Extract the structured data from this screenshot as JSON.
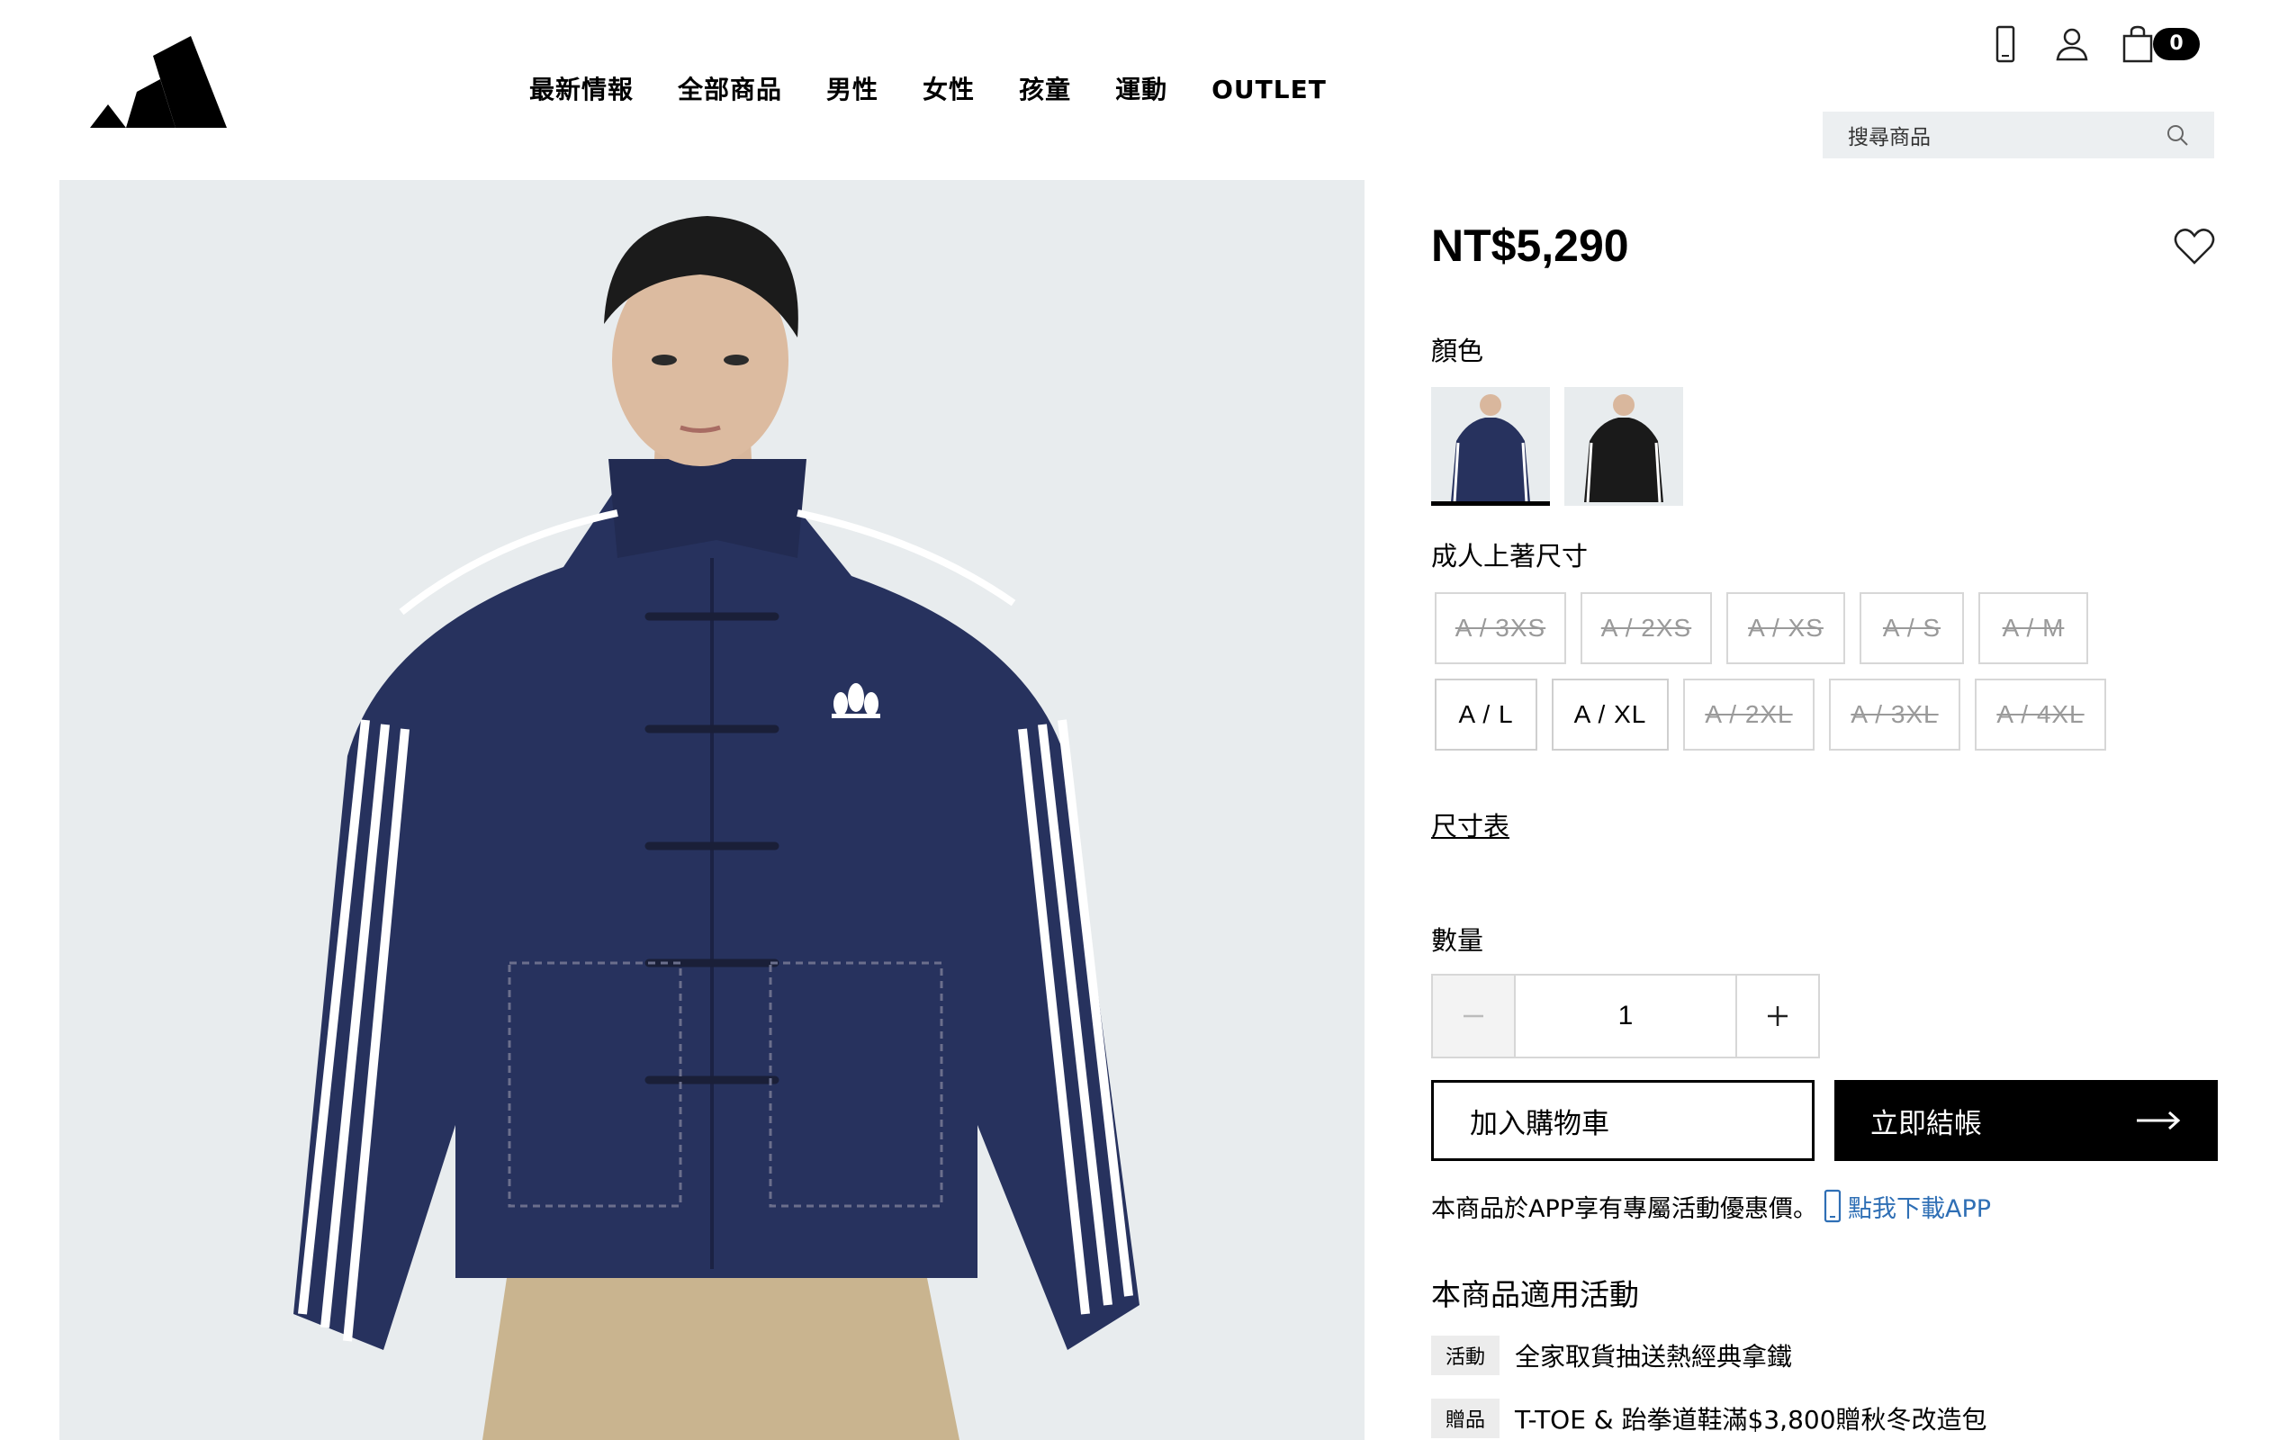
{
  "header": {
    "nav": [
      "最新情報",
      "全部商品",
      "男性",
      "女性",
      "孩童",
      "運動",
      "OUTLET"
    ],
    "cart_count": "0",
    "search_placeholder": "搜尋商品",
    "icons": [
      "adidas-logo",
      "mobile-icon",
      "user-icon",
      "bag-icon",
      "search-icon"
    ]
  },
  "product": {
    "price": "NT$5,290",
    "color_label": "顏色",
    "colors": [
      "navy-denim",
      "black"
    ],
    "size_label": "成人上著尺寸",
    "sizes": [
      [
        {
          "label": "A / 3XS",
          "available": false
        },
        {
          "label": "A / 2XS",
          "available": false
        },
        {
          "label": "A / XS",
          "available": false
        },
        {
          "label": "A / S",
          "available": false
        },
        {
          "label": "A / M",
          "available": false
        }
      ],
      [
        {
          "label": "A / L",
          "available": true
        },
        {
          "label": "A / XL",
          "available": true
        },
        {
          "label": "A / 2XL",
          "available": false
        },
        {
          "label": "A / 3XL",
          "available": false
        },
        {
          "label": "A / 4XL",
          "available": false
        }
      ]
    ],
    "size_chart": "尺寸表",
    "qty_label": "數量",
    "qty": "1",
    "add_to_cart": "加入購物車",
    "checkout": "立即結帳",
    "app_note": "本商品於APP享有專屬活動優惠價。",
    "app_link": "點我下載APP",
    "promo_title": "本商品適用活動",
    "promos": [
      {
        "tag": "活動",
        "text": "全家取貨抽送熱經典拿鐵"
      },
      {
        "tag": "贈品",
        "text": "T-TOE & 跆拳道鞋滿$3,800贈秋冬改造包"
      }
    ]
  },
  "colors": {
    "accent_link": "#2f6fb5",
    "image_bg": "#e8ecee",
    "jacket": "#27325e"
  }
}
